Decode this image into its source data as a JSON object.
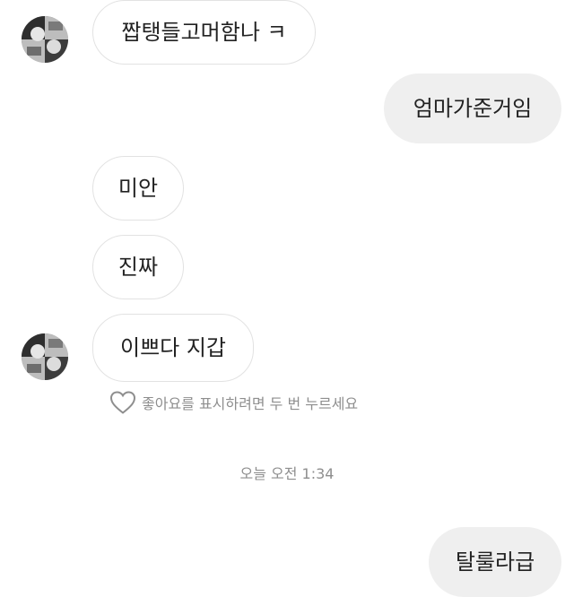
{
  "messages": [
    {
      "id": "m1",
      "sender": "other",
      "text": "짭탱들고머함나 ㅋ"
    },
    {
      "id": "m2",
      "sender": "me",
      "text": "엄마가준거임"
    },
    {
      "id": "m3",
      "sender": "other",
      "text": "미안"
    },
    {
      "id": "m4",
      "sender": "other",
      "text": "진짜"
    },
    {
      "id": "m5",
      "sender": "other",
      "text": "이쁘다 지갑"
    },
    {
      "id": "m6",
      "sender": "me",
      "text": "탈룰라급"
    }
  ],
  "like_hint": {
    "icon": "heart-outline-icon",
    "text": "좋아요를 표시하려면 두 번 누르세요"
  },
  "timestamp": "오늘 오전 1:34",
  "colors": {
    "outgoing_bubble": "#efefef",
    "incoming_border": "#e2e2e2",
    "muted_text": "#8e8e8e"
  }
}
